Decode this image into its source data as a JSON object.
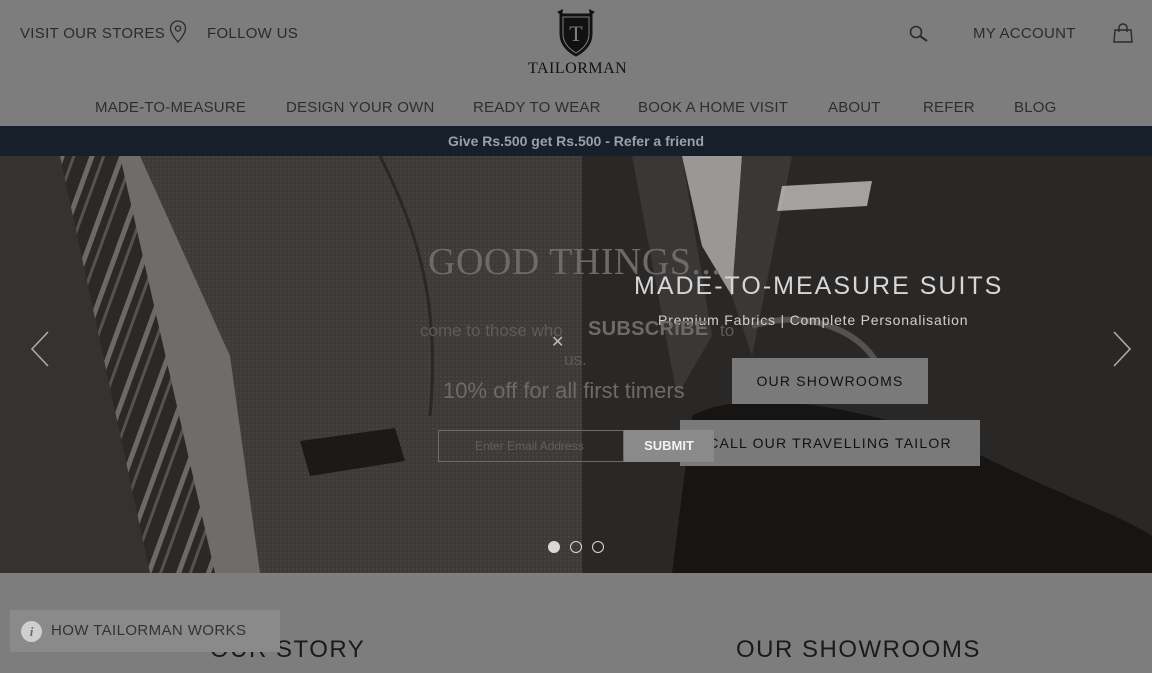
{
  "header": {
    "visit_stores": "VISIT OUR STORES",
    "follow_us": "FOLLOW US",
    "logo_text": "TAILORMAN",
    "logo_letter": "T",
    "my_account": "MY ACCOUNT"
  },
  "nav": {
    "items": [
      {
        "label": "MADE-TO-MEASURE"
      },
      {
        "label": "DESIGN YOUR OWN"
      },
      {
        "label": "READY TO WEAR"
      },
      {
        "label": "BOOK A HOME VISIT"
      },
      {
        "label": "ABOUT"
      },
      {
        "label": "REFER"
      },
      {
        "label": "BLOG"
      }
    ]
  },
  "promo": {
    "text": "Give Rs.500 get Rs.500 - Refer a friend"
  },
  "hero": {
    "title": "MADE-TO-MEASURE SUITS",
    "subtitle": "Premium Fabrics | Complete Personalisation",
    "btn_showrooms": "OUR SHOWROOMS",
    "btn_call": "CALL OUR TRAVELLING TAILOR",
    "slide_count": 3,
    "active_slide": 1
  },
  "popup": {
    "heading": "GOOD THINGS...",
    "line1": "come to those who",
    "subscribe": "SUBSCRIBE",
    "line1_to": "to",
    "line1_end": "us.",
    "close": "✕",
    "offer": "10% off for all first timers",
    "email_placeholder": "Enter Email Address",
    "submit": "SUBMIT"
  },
  "sections": {
    "our_story": "OUR STORY",
    "our_showrooms": "OUR SHOWROOMS"
  },
  "how_works": {
    "label": "HOW TAILORMAN WORKS",
    "icon_letter": "i"
  },
  "icons": {
    "pin": "location-pin-icon",
    "search": "search-icon",
    "bag": "shopping-bag-icon",
    "prev": "chevron-left-icon",
    "next": "chevron-right-icon",
    "info": "info-icon"
  },
  "colors": {
    "overlay": "#7d7d7d",
    "promo_bar": "#17202a",
    "button": "#7a7a7a"
  }
}
